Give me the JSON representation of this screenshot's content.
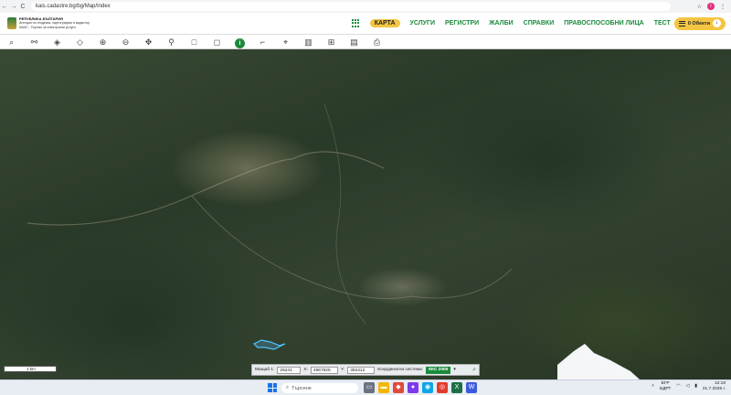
{
  "browser": {
    "back": "←",
    "forward": "→",
    "reload": "C",
    "url": "kais.cadastre.bg/bg/Map/Index",
    "star": "☆",
    "profile_initial": "I",
    "menu": "⋮"
  },
  "site": {
    "logo_title": "РЕПУБЛИКА БЪЛГАРИЯ",
    "logo_line2": "Агенция по геодезия, картография и кадастър",
    "logo_line3": "КАИС - Портал за електронни услуги",
    "menu": [
      {
        "label": "КАРТА",
        "active": true
      },
      {
        "label": "УСЛУГИ"
      },
      {
        "label": "РЕГИСТРИ"
      },
      {
        "label": "ЖАЛБИ"
      },
      {
        "label": "СПРАВКИ"
      },
      {
        "label": "ПРАВОСПОСОБНИ ЛИЦА"
      },
      {
        "label": "ТЕСТ"
      }
    ],
    "objects_label": "0 Обекти",
    "accent": "#1c8a3c",
    "highlight": "#f4c542"
  },
  "toolbar": {
    "tools": [
      {
        "icon": "search-icon",
        "glyph": "⌕"
      },
      {
        "icon": "layers-tree-icon",
        "glyph": "⚯"
      },
      {
        "icon": "layers-icon",
        "glyph": "◈"
      },
      {
        "icon": "stack-icon",
        "glyph": "◇"
      },
      {
        "icon": "zoom-in-icon",
        "glyph": "⊕"
      },
      {
        "icon": "zoom-out-icon",
        "glyph": "⊖"
      },
      {
        "icon": "pan-icon",
        "glyph": "✥"
      },
      {
        "icon": "location-pin-icon",
        "glyph": "⚲"
      },
      {
        "icon": "select-rectangle-icon",
        "glyph": "□"
      },
      {
        "icon": "select-area-icon",
        "glyph": "◻"
      },
      {
        "icon": "info-icon",
        "glyph": "i"
      },
      {
        "icon": "measure-angle-icon",
        "glyph": "⌐"
      },
      {
        "icon": "draw-polygon-icon",
        "glyph": "⌖"
      },
      {
        "icon": "map-book-icon",
        "glyph": "▥"
      },
      {
        "icon": "split-icon",
        "glyph": "⊞"
      },
      {
        "icon": "document-icon",
        "glyph": "▤"
      },
      {
        "icon": "print-icon",
        "glyph": "⎙"
      }
    ]
  },
  "map": {
    "scale_label": "1 km"
  },
  "coordinates": {
    "scale_label": "Мащаб 1:",
    "scale_value": "26241",
    "x_label": "X:",
    "x_value": "4667625",
    "y_label": "Y:",
    "y_value": "392412",
    "system_label": "Координатна система:",
    "system_value": "ККС 2005"
  },
  "taskbar": {
    "search_placeholder": "Търсене",
    "lang_line1": "БГР",
    "lang_line2": "БДРТ",
    "time": "12:18",
    "date": "21.7.2025 г."
  }
}
